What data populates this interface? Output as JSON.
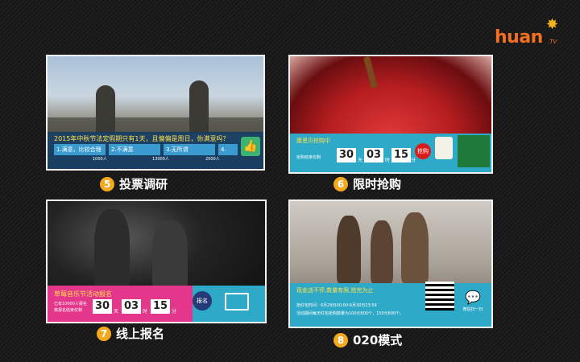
{
  "brand": {
    "logo": "huan",
    "tv": ".TV"
  },
  "cards": [
    {
      "number": "5",
      "caption": "投票调研",
      "question": "2015年中秋节法定假期只有1天，且偏偏是周日，你满意吗？",
      "options": [
        "1.满意，比较合理",
        "2.不满意",
        "3.无所谓",
        "4."
      ],
      "counts": [
        "1000人",
        "13000人",
        "2000人"
      ]
    },
    {
      "number": "6",
      "caption": "限时抢购",
      "title": "康恩贝抢购中",
      "subtitle": "抢购结束仅剩",
      "digits": [
        "30",
        "03",
        "15"
      ],
      "units": [
        "天",
        "时",
        "分"
      ],
      "badge": "抢购"
    },
    {
      "number": "7",
      "caption": "线上报名",
      "title": "草莓音乐节活动报名",
      "line1": "已有10000人报名",
      "line2": "离报名结束仅剩",
      "digits": [
        "30",
        "03",
        "15"
      ],
      "units": [
        "天",
        "时",
        "分"
      ],
      "badge": "报名"
    },
    {
      "number": "8",
      "caption": "020模式",
      "title": "现金送不停,数量有限,抢完为止",
      "line1": "抢红包时间：6月29日00:00-6月30日23:59",
      "line2": "活动期间每天红包抢购数量为100元600个，150元600个。",
      "wechat_label": "微信扫一扫"
    }
  ]
}
